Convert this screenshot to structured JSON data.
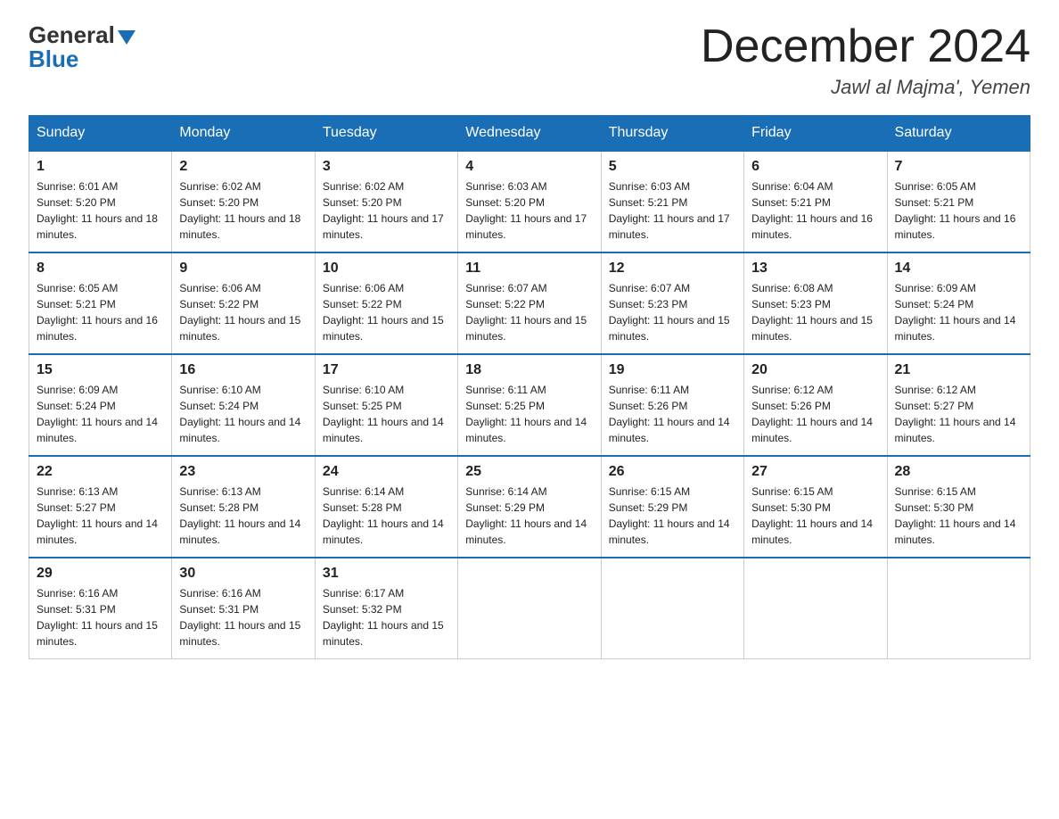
{
  "header": {
    "logo_general": "General",
    "logo_blue": "Blue",
    "month_title": "December 2024",
    "location": "Jawl al Majma', Yemen"
  },
  "weekdays": [
    "Sunday",
    "Monday",
    "Tuesday",
    "Wednesday",
    "Thursday",
    "Friday",
    "Saturday"
  ],
  "weeks": [
    [
      {
        "day": "1",
        "sunrise": "6:01 AM",
        "sunset": "5:20 PM",
        "daylight": "11 hours and 18 minutes."
      },
      {
        "day": "2",
        "sunrise": "6:02 AM",
        "sunset": "5:20 PM",
        "daylight": "11 hours and 18 minutes."
      },
      {
        "day": "3",
        "sunrise": "6:02 AM",
        "sunset": "5:20 PM",
        "daylight": "11 hours and 17 minutes."
      },
      {
        "day": "4",
        "sunrise": "6:03 AM",
        "sunset": "5:20 PM",
        "daylight": "11 hours and 17 minutes."
      },
      {
        "day": "5",
        "sunrise": "6:03 AM",
        "sunset": "5:21 PM",
        "daylight": "11 hours and 17 minutes."
      },
      {
        "day": "6",
        "sunrise": "6:04 AM",
        "sunset": "5:21 PM",
        "daylight": "11 hours and 16 minutes."
      },
      {
        "day": "7",
        "sunrise": "6:05 AM",
        "sunset": "5:21 PM",
        "daylight": "11 hours and 16 minutes."
      }
    ],
    [
      {
        "day": "8",
        "sunrise": "6:05 AM",
        "sunset": "5:21 PM",
        "daylight": "11 hours and 16 minutes."
      },
      {
        "day": "9",
        "sunrise": "6:06 AM",
        "sunset": "5:22 PM",
        "daylight": "11 hours and 15 minutes."
      },
      {
        "day": "10",
        "sunrise": "6:06 AM",
        "sunset": "5:22 PM",
        "daylight": "11 hours and 15 minutes."
      },
      {
        "day": "11",
        "sunrise": "6:07 AM",
        "sunset": "5:22 PM",
        "daylight": "11 hours and 15 minutes."
      },
      {
        "day": "12",
        "sunrise": "6:07 AM",
        "sunset": "5:23 PM",
        "daylight": "11 hours and 15 minutes."
      },
      {
        "day": "13",
        "sunrise": "6:08 AM",
        "sunset": "5:23 PM",
        "daylight": "11 hours and 15 minutes."
      },
      {
        "day": "14",
        "sunrise": "6:09 AM",
        "sunset": "5:24 PM",
        "daylight": "11 hours and 14 minutes."
      }
    ],
    [
      {
        "day": "15",
        "sunrise": "6:09 AM",
        "sunset": "5:24 PM",
        "daylight": "11 hours and 14 minutes."
      },
      {
        "day": "16",
        "sunrise": "6:10 AM",
        "sunset": "5:24 PM",
        "daylight": "11 hours and 14 minutes."
      },
      {
        "day": "17",
        "sunrise": "6:10 AM",
        "sunset": "5:25 PM",
        "daylight": "11 hours and 14 minutes."
      },
      {
        "day": "18",
        "sunrise": "6:11 AM",
        "sunset": "5:25 PM",
        "daylight": "11 hours and 14 minutes."
      },
      {
        "day": "19",
        "sunrise": "6:11 AM",
        "sunset": "5:26 PM",
        "daylight": "11 hours and 14 minutes."
      },
      {
        "day": "20",
        "sunrise": "6:12 AM",
        "sunset": "5:26 PM",
        "daylight": "11 hours and 14 minutes."
      },
      {
        "day": "21",
        "sunrise": "6:12 AM",
        "sunset": "5:27 PM",
        "daylight": "11 hours and 14 minutes."
      }
    ],
    [
      {
        "day": "22",
        "sunrise": "6:13 AM",
        "sunset": "5:27 PM",
        "daylight": "11 hours and 14 minutes."
      },
      {
        "day": "23",
        "sunrise": "6:13 AM",
        "sunset": "5:28 PM",
        "daylight": "11 hours and 14 minutes."
      },
      {
        "day": "24",
        "sunrise": "6:14 AM",
        "sunset": "5:28 PM",
        "daylight": "11 hours and 14 minutes."
      },
      {
        "day": "25",
        "sunrise": "6:14 AM",
        "sunset": "5:29 PM",
        "daylight": "11 hours and 14 minutes."
      },
      {
        "day": "26",
        "sunrise": "6:15 AM",
        "sunset": "5:29 PM",
        "daylight": "11 hours and 14 minutes."
      },
      {
        "day": "27",
        "sunrise": "6:15 AM",
        "sunset": "5:30 PM",
        "daylight": "11 hours and 14 minutes."
      },
      {
        "day": "28",
        "sunrise": "6:15 AM",
        "sunset": "5:30 PM",
        "daylight": "11 hours and 14 minutes."
      }
    ],
    [
      {
        "day": "29",
        "sunrise": "6:16 AM",
        "sunset": "5:31 PM",
        "daylight": "11 hours and 15 minutes."
      },
      {
        "day": "30",
        "sunrise": "6:16 AM",
        "sunset": "5:31 PM",
        "daylight": "11 hours and 15 minutes."
      },
      {
        "day": "31",
        "sunrise": "6:17 AM",
        "sunset": "5:32 PM",
        "daylight": "11 hours and 15 minutes."
      },
      null,
      null,
      null,
      null
    ]
  ]
}
